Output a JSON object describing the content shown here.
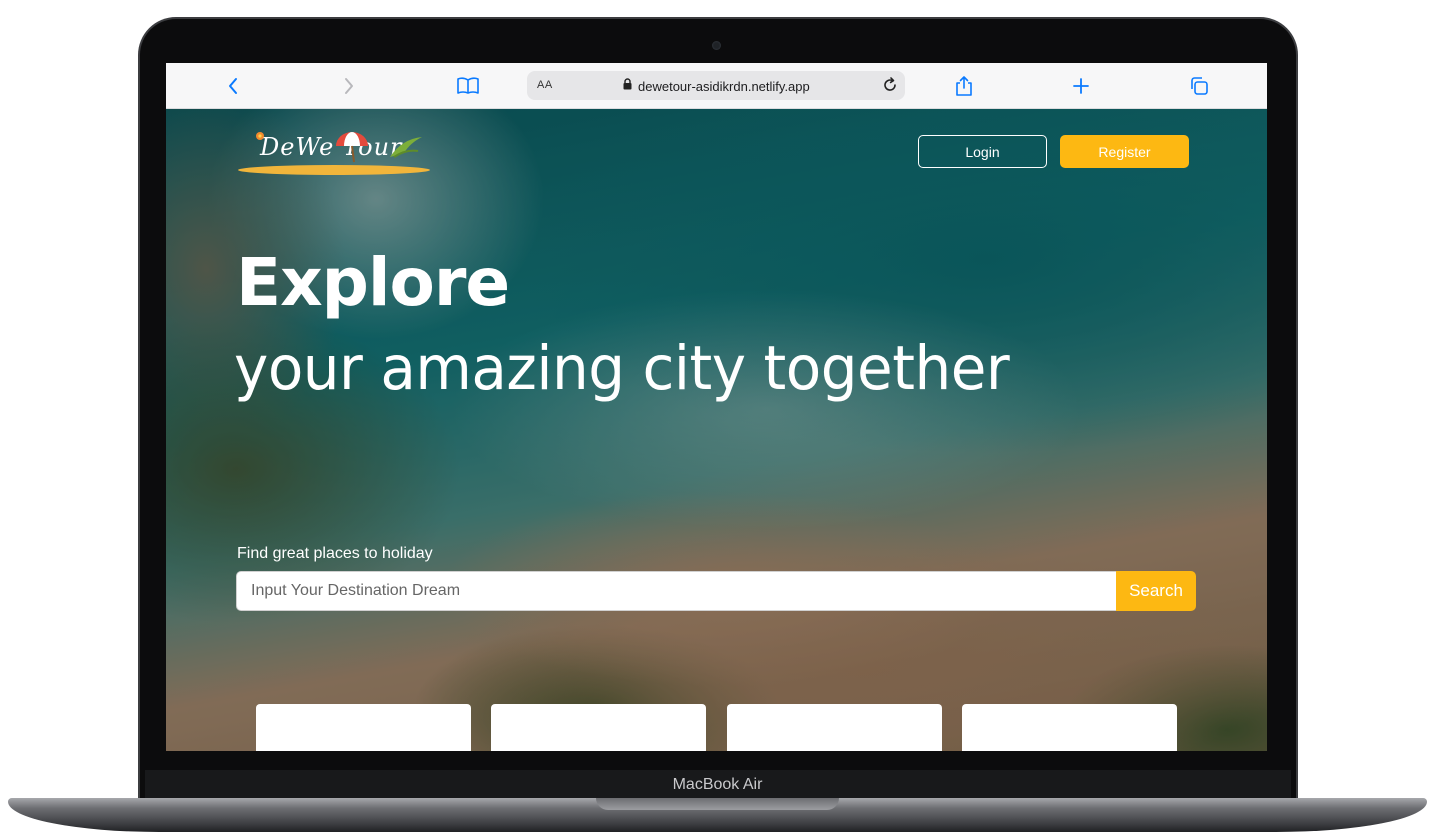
{
  "device": {
    "model_label": "MacBook Air"
  },
  "browser": {
    "text_size_button": "AA",
    "url": "dewetour-asidikrdn.netlify.app",
    "icons": {
      "back": "chevron-left-icon",
      "forward": "chevron-right-icon",
      "bookmarks": "book-icon",
      "lock": "lock-icon",
      "reload": "reload-icon",
      "share": "share-icon",
      "new_tab": "plus-icon",
      "tabs": "tabs-icon"
    },
    "accent_color": "#0a7aff"
  },
  "site": {
    "logo_text": "DeWe Tour",
    "nav": {
      "login_label": "Login",
      "register_label": "Register"
    },
    "hero": {
      "title": "Explore",
      "subtitle": "your amazing city together"
    },
    "search": {
      "label": "Find great places to holiday",
      "placeholder": "Input Your Destination Dream",
      "value": "",
      "button_label": "Search"
    },
    "colors": {
      "brand_yellow": "#fdb812",
      "text_on_hero": "#ffffff"
    }
  }
}
